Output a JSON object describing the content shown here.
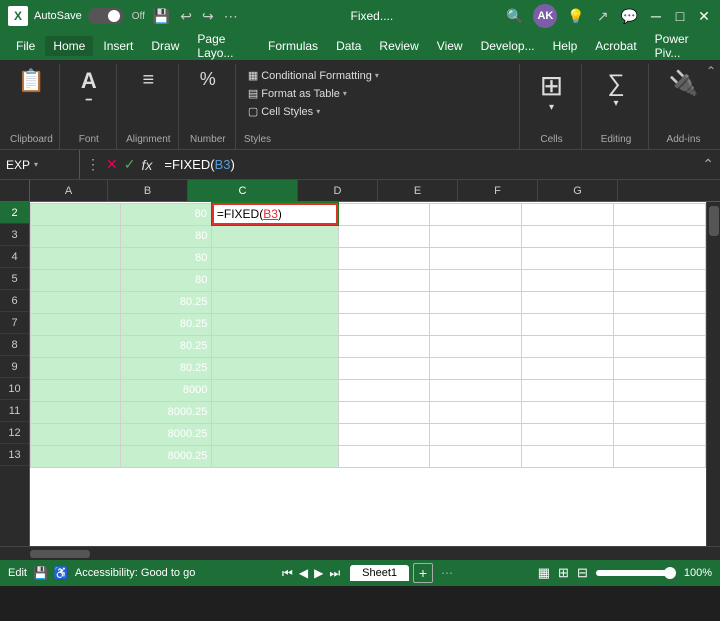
{
  "titlebar": {
    "app": "XL",
    "autosave_label": "AutoSave",
    "toggle_state": "Off",
    "title": "Fixed....",
    "avatar_initials": "AK",
    "close_label": "✕",
    "minimize_label": "─",
    "maximize_label": "□"
  },
  "menubar": {
    "items": [
      "File",
      "Home",
      "Insert",
      "Draw",
      "Page Layout",
      "Formulas",
      "Data",
      "Review",
      "View",
      "Developer",
      "Help",
      "Acrobat",
      "Power Pivot"
    ]
  },
  "ribbon": {
    "groups": {
      "clipboard": {
        "label": "Clipboard",
        "icon": "📋"
      },
      "font": {
        "label": "Font",
        "icon": "A"
      },
      "alignment": {
        "label": "Alignment",
        "icon": "≡"
      },
      "number": {
        "label": "Number",
        "icon": "#"
      },
      "styles": {
        "label": "Styles",
        "items": [
          "Conditional Formatting ▾",
          "Format as Table ▾",
          "Cell Styles ▾"
        ]
      },
      "cells": {
        "label": "Cells",
        "icon": "⊞"
      },
      "editing": {
        "label": "Editing",
        "icon": "✏"
      },
      "addins": {
        "label": "Add-ins",
        "icon": "🔧"
      }
    }
  },
  "formulabar": {
    "namebox": "EXP",
    "formula": "=FIXED(B3)",
    "formula_parts": {
      "prefix": "=FIXED(",
      "ref": "B3",
      "suffix": ")"
    }
  },
  "spreadsheet": {
    "columns": [
      "A",
      "B",
      "C",
      "D",
      "E",
      "F",
      "G"
    ],
    "active_col": "C",
    "rows": [
      {
        "num": "2",
        "b": "80",
        "c_formula": "=FIXED(B3)",
        "c_active": true
      },
      {
        "num": "3",
        "b": "80",
        "c": ""
      },
      {
        "num": "4",
        "b": "80",
        "c": ""
      },
      {
        "num": "5",
        "b": "80",
        "c": ""
      },
      {
        "num": "6",
        "b": "80.25",
        "c": ""
      },
      {
        "num": "7",
        "b": "80.25",
        "c": ""
      },
      {
        "num": "8",
        "b": "80.25",
        "c": ""
      },
      {
        "num": "9",
        "b": "80.25",
        "c": ""
      },
      {
        "num": "10",
        "b": "8000",
        "c": ""
      },
      {
        "num": "11",
        "b": "8000.25",
        "c": ""
      },
      {
        "num": "12",
        "b": "8000.25",
        "c": ""
      },
      {
        "num": "13",
        "b": "8000.25",
        "c": ""
      }
    ]
  },
  "statusbar": {
    "mode": "Edit",
    "accessibility": "Accessibility: Good to go",
    "sheet": "Sheet1",
    "zoom": "100%"
  }
}
